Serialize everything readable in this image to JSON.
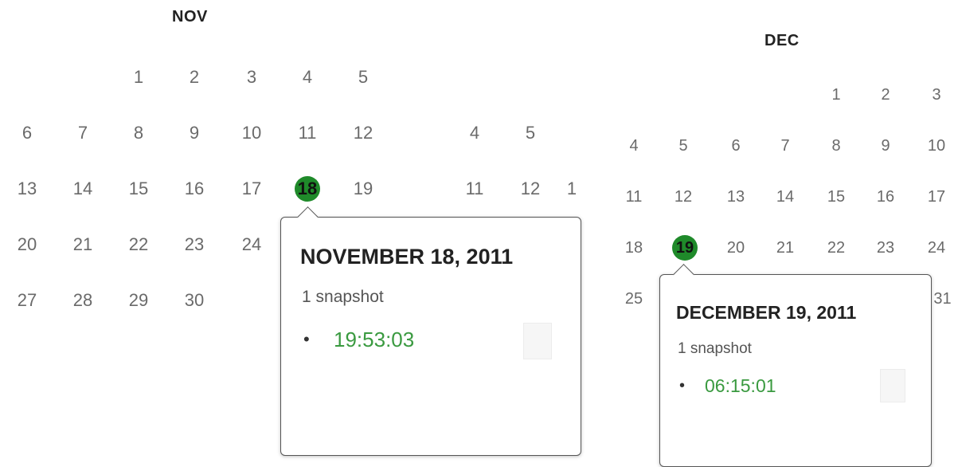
{
  "nov": {
    "title": "NOV",
    "rows": [
      [
        "",
        "",
        "1",
        "2",
        "3",
        "4",
        "5"
      ],
      [
        "6",
        "7",
        "8",
        "9",
        "10",
        "11",
        "12"
      ],
      [
        "13",
        "14",
        "15",
        "16",
        "17",
        "18",
        "19"
      ],
      [
        "20",
        "21",
        "22",
        "23",
        "24",
        "",
        ""
      ],
      [
        "27",
        "28",
        "29",
        "30",
        "",
        "",
        ""
      ]
    ],
    "marked_day": "18",
    "popover": {
      "title": "NOVEMBER 18, 2011",
      "count": "1 snapshot",
      "bullet": "•",
      "time": "19:53:03"
    }
  },
  "middle_partial": {
    "rows": [
      [
        "4",
        "5"
      ],
      [
        "11",
        "12",
        "1"
      ]
    ]
  },
  "dec": {
    "title": "DEC",
    "rows": [
      [
        "",
        "",
        "",
        "",
        "1",
        "2",
        "3"
      ],
      [
        "4",
        "5",
        "6",
        "7",
        "8",
        "9",
        "10"
      ],
      [
        "11",
        "12",
        "13",
        "14",
        "15",
        "16",
        "17"
      ],
      [
        "18",
        "19",
        "20",
        "21",
        "22",
        "23",
        "24"
      ],
      [
        "25",
        "",
        "",
        "",
        "",
        "",
        "31"
      ]
    ],
    "marked_day": "19",
    "popover": {
      "title": "DECEMBER 19, 2011",
      "count": "1 snapshot",
      "bullet": "•",
      "time": "06:15:01"
    }
  },
  "colors": {
    "marker": "#1f8a2a",
    "time_link": "#3a9a40"
  }
}
